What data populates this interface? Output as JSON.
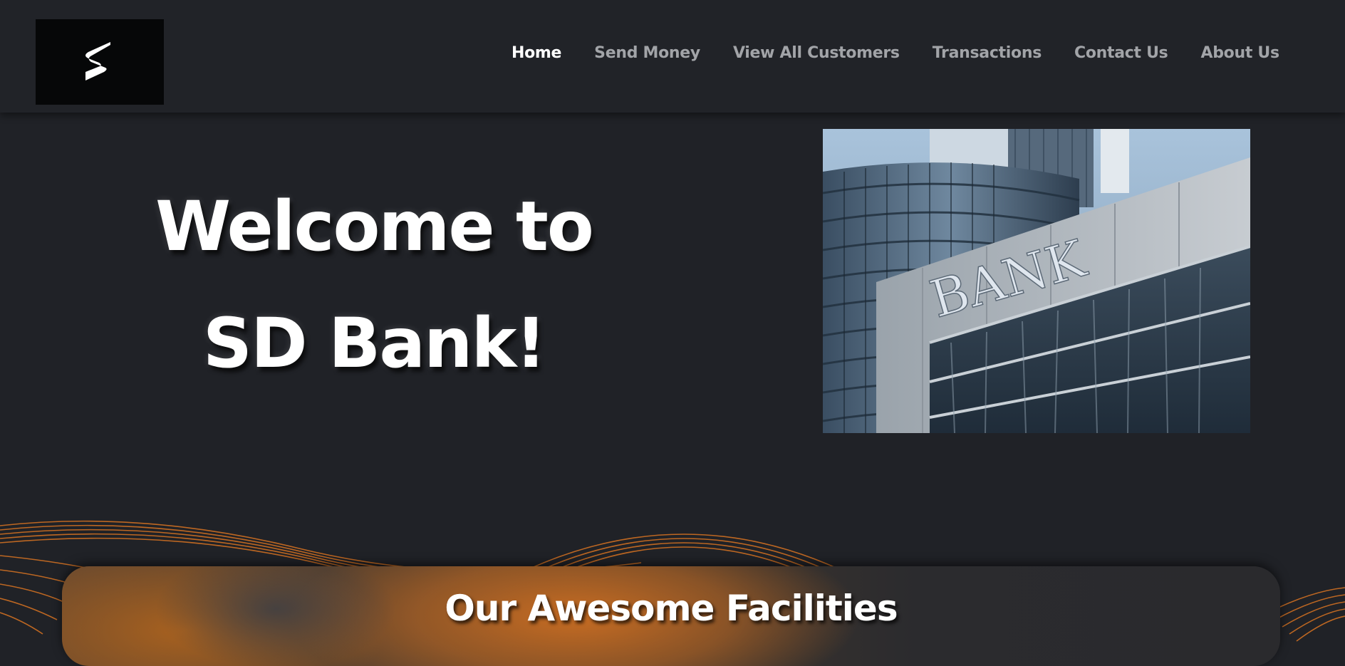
{
  "brand": {
    "logo_icon": "s-logo-icon"
  },
  "nav": {
    "items": [
      {
        "label": "Home",
        "active": true
      },
      {
        "label": "Send Money",
        "active": false
      },
      {
        "label": "View All Customers",
        "active": false
      },
      {
        "label": "Transactions",
        "active": false
      },
      {
        "label": "Contact Us",
        "active": false
      },
      {
        "label": "About Us",
        "active": false
      }
    ]
  },
  "hero": {
    "title_line1": "Welcome to",
    "title_line2": "SD Bank!",
    "image_sign_text": "BANK"
  },
  "facilities": {
    "title": "Our Awesome Facilities"
  },
  "colors": {
    "background": "#202227",
    "header": "#212328",
    "accent_orange": "#c76c22",
    "nav_inactive": "#a2a4a8",
    "nav_active": "#ffffff"
  }
}
